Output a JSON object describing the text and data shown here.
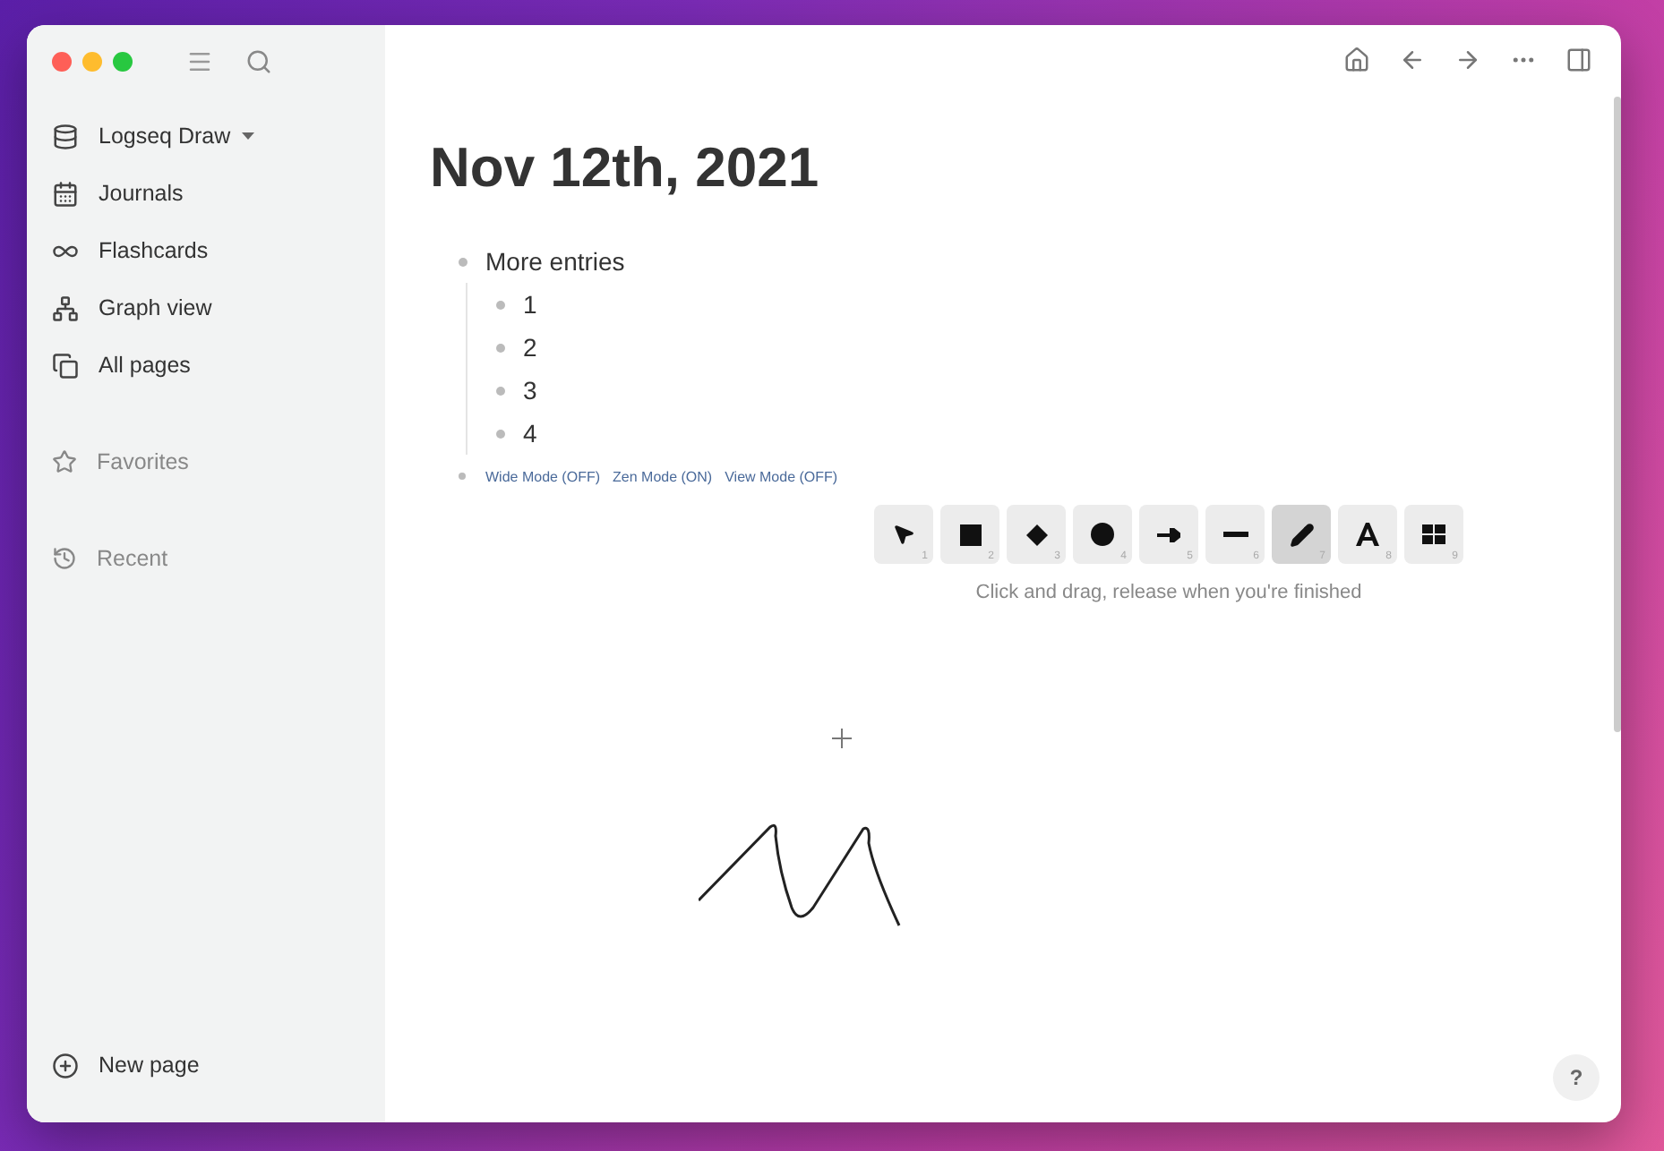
{
  "sidebar": {
    "repo": {
      "label": "Logseq Draw"
    },
    "nav": [
      {
        "label": "Journals",
        "kind": "calendar"
      },
      {
        "label": "Flashcards",
        "kind": "infinity"
      },
      {
        "label": "Graph view",
        "kind": "graph"
      },
      {
        "label": "All pages",
        "kind": "pages"
      }
    ],
    "sections": [
      {
        "label": "Favorites",
        "kind": "star"
      },
      {
        "label": "Recent",
        "kind": "history"
      }
    ],
    "new_page": {
      "label": "New page"
    }
  },
  "page": {
    "title": "Nov 12th, 2021",
    "blocks": [
      {
        "text": "More entries",
        "children": [
          {
            "text": "1"
          },
          {
            "text": "2"
          },
          {
            "text": "3"
          },
          {
            "text": "4"
          }
        ]
      }
    ],
    "mode_links": [
      "Wide Mode (OFF)",
      "Zen Mode (ON)",
      "View Mode (OFF)"
    ]
  },
  "draw_toolbar": {
    "tools": [
      {
        "kind": "select",
        "hotkey": "1",
        "selected": false
      },
      {
        "kind": "rect",
        "hotkey": "2",
        "selected": false
      },
      {
        "kind": "diamond",
        "hotkey": "3",
        "selected": false
      },
      {
        "kind": "ellipse",
        "hotkey": "4",
        "selected": false
      },
      {
        "kind": "arrow",
        "hotkey": "5",
        "selected": false
      },
      {
        "kind": "line",
        "hotkey": "6",
        "selected": false
      },
      {
        "kind": "pencil",
        "hotkey": "7",
        "selected": true
      },
      {
        "kind": "text",
        "hotkey": "8",
        "selected": false
      },
      {
        "kind": "library",
        "hotkey": "9",
        "selected": false
      }
    ],
    "hint": "Click and drag, release when you're finished"
  },
  "help": "?"
}
